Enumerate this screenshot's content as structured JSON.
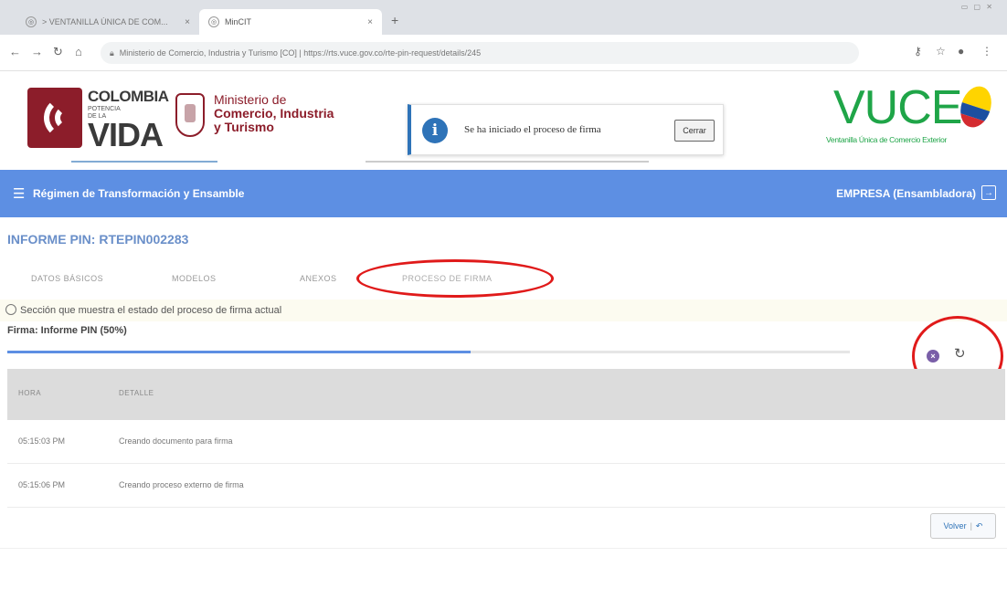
{
  "browser": {
    "tabs": [
      {
        "label": "> VENTANILLA ÚNICA DE COM..."
      },
      {
        "label": "MinCIT"
      }
    ],
    "new_tab": "+",
    "url": "Ministerio de Comercio, Industria y Turismo [CO]  |  https://rts.vuce.gov.co/rte-pin-request/details/245"
  },
  "header": {
    "colombia_line1": "COLOMBIA",
    "colombia_line2": "POTENCIA DE LA",
    "colombia_line3": "VIDA",
    "ministerio_line1": "Ministerio de",
    "ministerio_line2": "Comercio, Industria",
    "ministerio_line3": "y Turismo",
    "vuce_title": "VUCE",
    "vuce_subtitle": "Ventanilla Única de Comercio Exterior"
  },
  "toast": {
    "message": "Se ha iniciado el proceso de firma",
    "close_label": "Cerrar"
  },
  "module": {
    "title": "Régimen de Transformación y Ensamble",
    "user": "EMPRESA (Ensambladora)"
  },
  "page": {
    "title": "INFORME PIN: RTEPIN002283",
    "tabs": [
      "DATOS BÁSICOS",
      "MODELOS",
      "ANEXOS",
      "PROCESO DE FIRMA"
    ],
    "notice": "Sección que muestra el estado del proceso de firma actual",
    "firma_label": "Firma: Informe PIN (50%)",
    "progress_fraction": 0.55
  },
  "table": {
    "headers": [
      "HORA",
      "DETALLE"
    ],
    "rows": [
      [
        "05:15:03 PM",
        "Creando documento para firma"
      ],
      [
        "05:15:06 PM",
        "Creando proceso externo de firma"
      ]
    ]
  },
  "actions": {
    "volver_label": "Volver"
  },
  "colors": {
    "module_bar": "#5d8fe3",
    "title_blue": "#6a8fc9",
    "annotation_red": "#e01a1a",
    "vuce_green": "#1fa548",
    "ministry_red": "#8c1d2a"
  }
}
